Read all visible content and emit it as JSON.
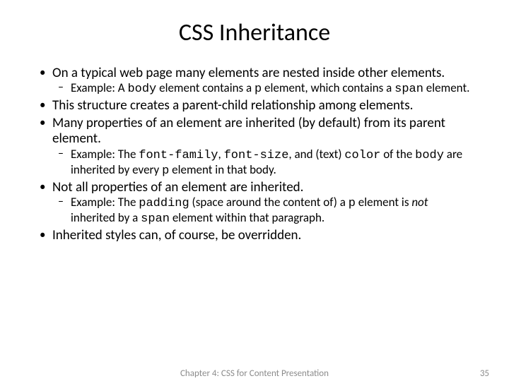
{
  "title": "CSS Inheritance",
  "bullets": {
    "b1": "On a typical web page many elements are nested inside other elements.",
    "b1s_a": "Example: A ",
    "b1s_body": "body",
    "b1s_b": " element contains a ",
    "b1s_p": "p",
    "b1s_c": " element, which contains a ",
    "b1s_span": "span",
    "b1s_d": " element.",
    "b2": "This structure creates a parent-child relationship among elements.",
    "b3": "Many properties of an element are inherited (by default) from its parent element.",
    "b3s_a": "Example: The ",
    "b3s_ff": "font-family",
    "b3s_b": ", ",
    "b3s_fs": "font-size",
    "b3s_c": ", and (text) ",
    "b3s_color": "color",
    "b3s_d": " of the ",
    "b3s_body": "body",
    "b3s_e": " are inherited by every ",
    "b3s_p": "p",
    "b3s_f": " element in that body.",
    "b4": "Not all properties of an element are inherited.",
    "b4s_a": "Example: The ",
    "b4s_pad": "padding",
    "b4s_b": " (space around the content of) a ",
    "b4s_p": "p",
    "b4s_c": " element is ",
    "b4s_not": "not",
    "b4s_d": " inherited by a ",
    "b4s_span": "span",
    "b4s_e": " element within that paragraph.",
    "b5": "Inherited styles can, of course, be overridden."
  },
  "footer": {
    "center": "Chapter 4: CSS for Content Presentation",
    "page": "35"
  }
}
